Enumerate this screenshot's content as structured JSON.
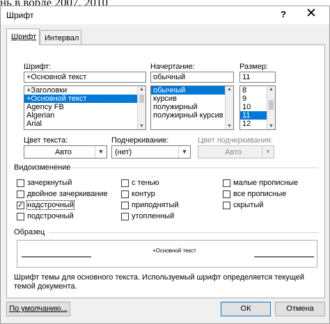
{
  "background_doc": {
    "text": "нь в ворде 2007, 2010"
  },
  "dialog": {
    "title": "Шрифт",
    "help": "?",
    "close": "✕"
  },
  "tabs": [
    {
      "label": "Шрифт",
      "active": true
    },
    {
      "label": "Интервал",
      "active": false
    }
  ],
  "font": {
    "label": "Шрифт:",
    "value": "+Основной текст",
    "list": [
      "+Заголовки",
      "+Основной текст",
      "Agency FB",
      "Algerian",
      "Arial"
    ],
    "selected_index": 1
  },
  "style": {
    "label": "Начертание:",
    "value": "обычный",
    "list": [
      "обычный",
      "курсив",
      "полужирный",
      "полужирный курсив"
    ],
    "selected_index": 0
  },
  "size": {
    "label": "Размер:",
    "value": "11",
    "list": [
      "8",
      "9",
      "10",
      "11",
      "12"
    ],
    "selected_index": 3
  },
  "color": {
    "label": "Цвет текста:",
    "value": "Авто"
  },
  "underline": {
    "label": "Подчеркивание:",
    "value": "(нет)"
  },
  "underline_color": {
    "label": "Цвет подчеркивания:",
    "value": "Авто"
  },
  "effects": {
    "label": "Видоизменение",
    "items": [
      {
        "label": "зачеркнутый",
        "checked": false
      },
      {
        "label": "двойное зачеркивание",
        "checked": false
      },
      {
        "label": "надстрочный",
        "checked": true
      },
      {
        "label": "подстрочный",
        "checked": false
      },
      {
        "label": "с тенью",
        "checked": false
      },
      {
        "label": "контур",
        "checked": false
      },
      {
        "label": "приподнятый",
        "checked": false
      },
      {
        "label": "утопленный",
        "checked": false
      },
      {
        "label": "малые прописные",
        "checked": false
      },
      {
        "label": "все прописные",
        "checked": false
      },
      {
        "label": "скрытый",
        "checked": false
      }
    ]
  },
  "preview": {
    "label": "Образец",
    "sample": "+Основной текст",
    "description": "Шрифт темы для основного текста. Используемый шрифт определяется текущей темой документа."
  },
  "buttons": {
    "default": "По умолчанию...",
    "ok": "ОК",
    "cancel": "Отмена"
  }
}
